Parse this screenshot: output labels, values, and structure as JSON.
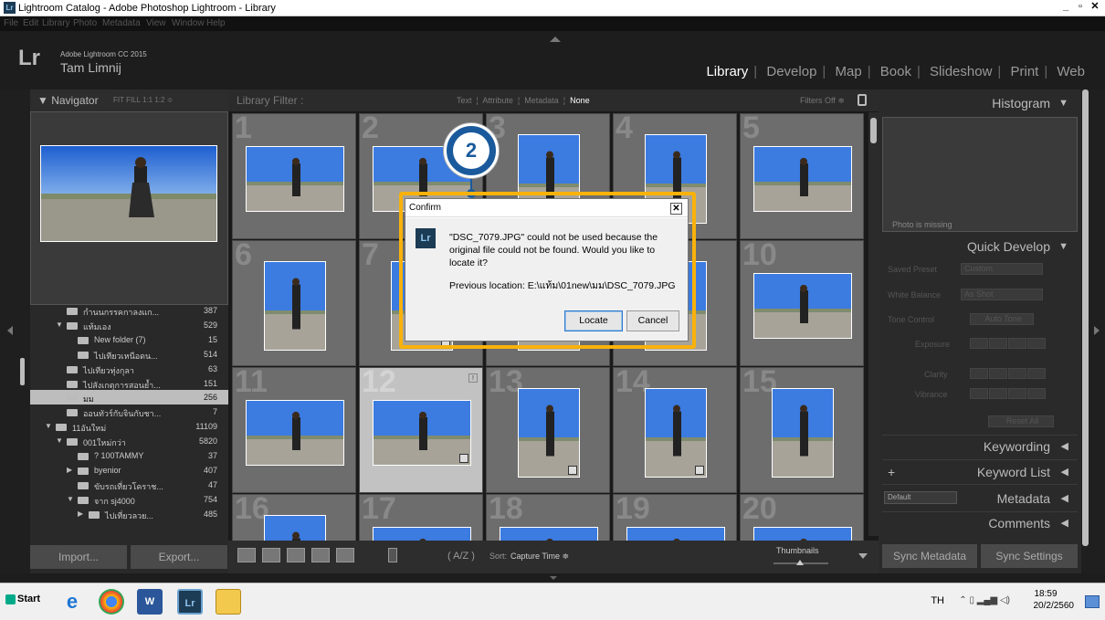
{
  "window": {
    "title": "Lightroom Catalog - Adobe Photoshop Lightroom - Library",
    "icon": "Lr"
  },
  "menu": [
    "File",
    "Edit",
    "Library",
    "Photo",
    "Metadata",
    "View",
    "Window",
    "Help"
  ],
  "identity": {
    "logo": "Lr",
    "product": "Adobe Lightroom CC 2015",
    "user": "Tam Limnij"
  },
  "modules": {
    "items": [
      "Library",
      "Develop",
      "Map",
      "Book",
      "Slideshow",
      "Print",
      "Web"
    ],
    "active": "Library",
    "separator": "|"
  },
  "navigator": {
    "title": "▼ Navigator",
    "zoom": "FIT   FILL   1:1   1:2 ≑"
  },
  "folders": [
    {
      "name": "กำนนกรรคกาลงแก...",
      "count": "387",
      "indent": 1,
      "tri": ""
    },
    {
      "name": "แท้มเอง",
      "count": "529",
      "indent": 1,
      "tri": "▼"
    },
    {
      "name": "New folder (7)",
      "count": "15",
      "indent": 2,
      "tri": ""
    },
    {
      "name": "ไปเทียวเหนือดน...",
      "count": "514",
      "indent": 2,
      "tri": ""
    },
    {
      "name": "ไปเทียวทุ่งกุลา",
      "count": "63",
      "indent": 1,
      "tri": ""
    },
    {
      "name": "ไปสังเกตุการสอนย้ำ...",
      "count": "151",
      "indent": 1,
      "tri": ""
    },
    {
      "name": "มม",
      "count": "256",
      "indent": 1,
      "tri": "▹",
      "selected": true
    },
    {
      "name": "ออนทัวร์กับจินกับชา...",
      "count": "7",
      "indent": 1,
      "tri": ""
    },
    {
      "name": "11อันใหม่",
      "count": "11109",
      "indent": 0,
      "tri": "▼"
    },
    {
      "name": "001ใหม่กว่า",
      "count": "5820",
      "indent": 1,
      "tri": "▼"
    },
    {
      "name": "? 100TAMMY",
      "count": "37",
      "indent": 2,
      "tri": ""
    },
    {
      "name": "byenior",
      "count": "407",
      "indent": 2,
      "tri": "▶"
    },
    {
      "name": "ขับรถเที่ยวโคราช...",
      "count": "47",
      "indent": 2,
      "tri": ""
    },
    {
      "name": "จาก sj4000",
      "count": "754",
      "indent": 2,
      "tri": "▼"
    },
    {
      "name": "ไปเที่ยวลวย...",
      "count": "485",
      "indent": 3,
      "tri": "▶"
    }
  ],
  "left_buttons": {
    "import": "Import...",
    "export": "Export..."
  },
  "filter": {
    "label": "Library Filter :",
    "text": "Text",
    "attribute": "Attribute",
    "metadata": "Metadata",
    "none": "None",
    "status": "Filters Off ≑"
  },
  "grid_numbers": [
    "1",
    "2",
    "3",
    "4",
    "5",
    "6",
    "7",
    "8",
    "9",
    "10",
    "11",
    "12",
    "13",
    "14",
    "15",
    "16",
    "17",
    "18",
    "19",
    "20"
  ],
  "toolbar": {
    "sort_label": "Sort:",
    "sort_value": "Capture Time ≑",
    "thumbnails": "Thumbnails"
  },
  "right": {
    "histogram": "Histogram",
    "photo_missing": "Photo is missing",
    "quick_develop": "Quick Develop",
    "saved_preset": "Saved Preset",
    "saved_preset_val": "Custom",
    "white_balance": "White Balance",
    "white_balance_val": "As Shot",
    "tone_control": "Tone Control",
    "auto_tone": "Auto Tone",
    "exposure": "Exposure",
    "clarity": "Clarity",
    "vibrance": "Vibrance",
    "reset_all": "Reset All",
    "keywording": "Keywording",
    "keyword_list": "Keyword List",
    "metadata": "Metadata",
    "metadata_preset": "Default",
    "comments": "Comments",
    "sync_metadata": "Sync Metadata",
    "sync_settings": "Sync Settings"
  },
  "dialog": {
    "title": "Confirm",
    "message": "\"DSC_7079.JPG\" could not be used because the original file could not be found. Would you like to locate it?",
    "location": "Previous location: E:\\แท้ม\\01new\\มม\\DSC_7079.JPG",
    "locate": "Locate",
    "cancel": "Cancel",
    "icon": "Lr"
  },
  "marker": "2",
  "taskbar": {
    "start": "Start",
    "lang": "TH",
    "time": "18:59",
    "date": "20/2/2560"
  },
  "colors": {
    "callout": "#f9b20b",
    "marker": "#1a5a9c"
  }
}
